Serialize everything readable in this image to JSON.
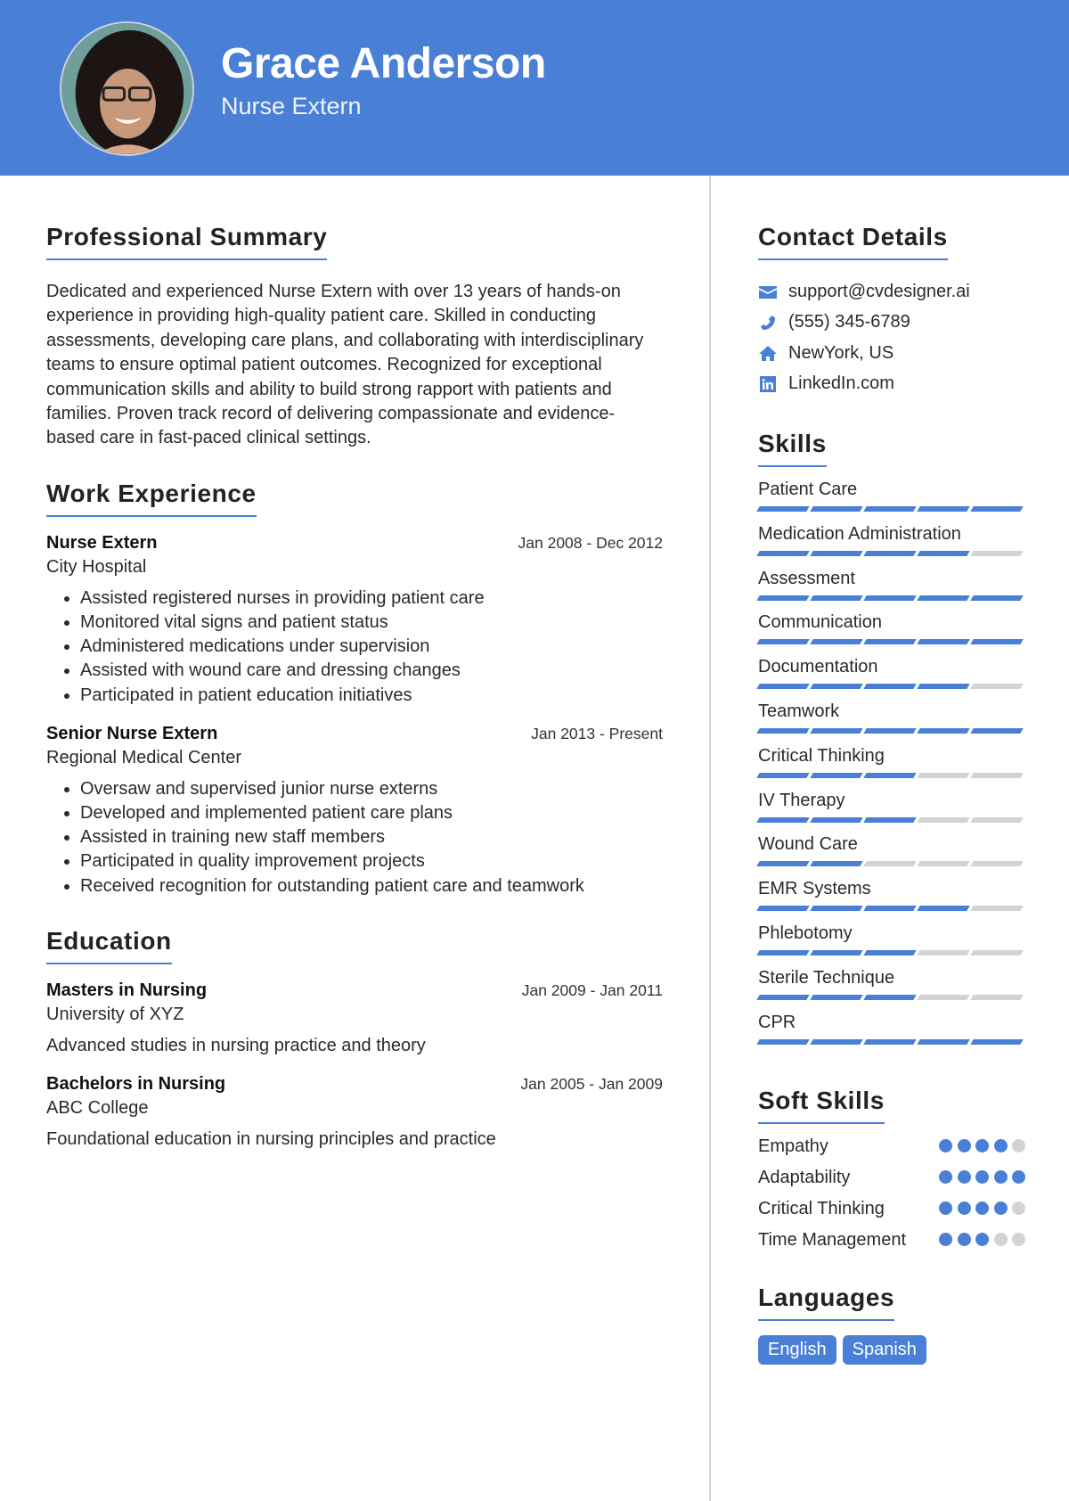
{
  "header": {
    "name": "Grace Anderson",
    "role": "Nurse Extern",
    "accent_color": "#4a7fd6"
  },
  "summary": {
    "title": "Professional Summary",
    "text": "Dedicated and experienced Nurse Extern with over 13 years of hands-on experience in providing high-quality patient care. Skilled in conducting assessments, developing care plans, and collaborating with interdisciplinary teams to ensure optimal patient outcomes. Recognized for exceptional communication skills and ability to build strong rapport with patients and families. Proven track record of delivering compassionate and evidence-based care in fast-paced clinical settings."
  },
  "experience": {
    "title": "Work Experience",
    "jobs": [
      {
        "title": "Nurse Extern",
        "org": "City Hospital",
        "date": "Jan 2008 - Dec 2012",
        "bullets": [
          "Assisted registered nurses in providing patient care",
          "Monitored vital signs and patient status",
          "Administered medications under supervision",
          "Assisted with wound care and dressing changes",
          "Participated in patient education initiatives"
        ]
      },
      {
        "title": "Senior Nurse Extern",
        "org": "Regional Medical Center",
        "date": "Jan 2013 - Present",
        "bullets": [
          "Oversaw and supervised junior nurse externs",
          "Developed and implemented patient care plans",
          "Assisted in training new staff members",
          "Participated in quality improvement projects",
          "Received recognition for outstanding patient care and teamwork"
        ]
      }
    ]
  },
  "education": {
    "title": "Education",
    "items": [
      {
        "degree": "Masters in Nursing",
        "school": "University of XYZ",
        "date": "Jan 2009 - Jan 2011",
        "desc": "Advanced studies in nursing practice and theory"
      },
      {
        "degree": "Bachelors in Nursing",
        "school": "ABC College",
        "date": "Jan 2005 - Jan 2009",
        "desc": "Foundational education in nursing principles and practice"
      }
    ]
  },
  "contact": {
    "title": "Contact Details",
    "items": [
      {
        "icon": "envelope-icon",
        "text": "support@cvdesigner.ai"
      },
      {
        "icon": "phone-icon",
        "text": "(555) 345-6789"
      },
      {
        "icon": "home-icon",
        "text": "NewYork, US"
      },
      {
        "icon": "linkedin-icon",
        "text": "LinkedIn.com"
      }
    ]
  },
  "skills": {
    "title": "Skills",
    "max_level": 5,
    "items": [
      {
        "name": "Patient Care",
        "level": 5
      },
      {
        "name": "Medication Administration",
        "level": 4
      },
      {
        "name": "Assessment",
        "level": 5
      },
      {
        "name": "Communication",
        "level": 5
      },
      {
        "name": "Documentation",
        "level": 4
      },
      {
        "name": "Teamwork",
        "level": 5
      },
      {
        "name": "Critical Thinking",
        "level": 3
      },
      {
        "name": "IV Therapy",
        "level": 3
      },
      {
        "name": "Wound Care",
        "level": 2
      },
      {
        "name": "EMR Systems",
        "level": 4
      },
      {
        "name": "Phlebotomy",
        "level": 3
      },
      {
        "name": "Sterile Technique",
        "level": 3
      },
      {
        "name": "CPR",
        "level": 5
      }
    ]
  },
  "soft_skills": {
    "title": "Soft Skills",
    "max_level": 5,
    "items": [
      {
        "name": "Empathy",
        "level": 4
      },
      {
        "name": "Adaptability",
        "level": 5
      },
      {
        "name": "Critical Thinking",
        "level": 4
      },
      {
        "name": "Time Management",
        "level": 3
      }
    ]
  },
  "languages": {
    "title": "Languages",
    "items": [
      "English",
      "Spanish"
    ]
  }
}
